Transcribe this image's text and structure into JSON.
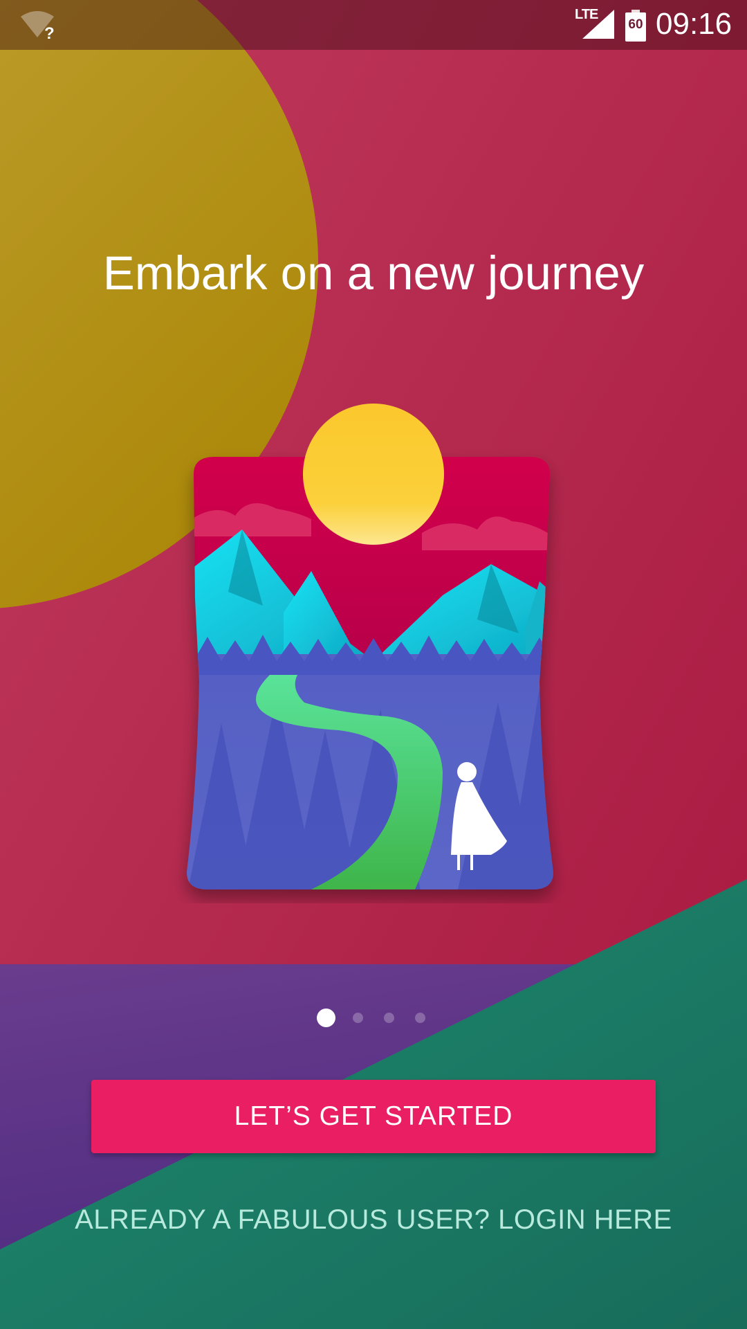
{
  "status_bar": {
    "wifi_icon": "wifi-unknown-icon",
    "wifi_glyph": "?",
    "network_type": "LTE",
    "signal_icon": "cell-signal-icon",
    "battery_icon": "battery-icon",
    "battery_level": "60",
    "time": "09:16"
  },
  "onboarding": {
    "headline": "Embark on a new journey",
    "illustration_icon": "journey-landscape-illustration",
    "pager": {
      "pages": 4,
      "current": 1
    },
    "primary_button": "LET’S GET STARTED",
    "login_link": "ALREADY A FABULOUS USER? LOGIN HERE"
  },
  "colors": {
    "background": "#b4294f",
    "yellow_shape": "#b8980f",
    "purple_shape": "#5b3387",
    "green_shape": "#1c7e68",
    "button": "#e91e63",
    "login_text": "#b7e9dd"
  }
}
